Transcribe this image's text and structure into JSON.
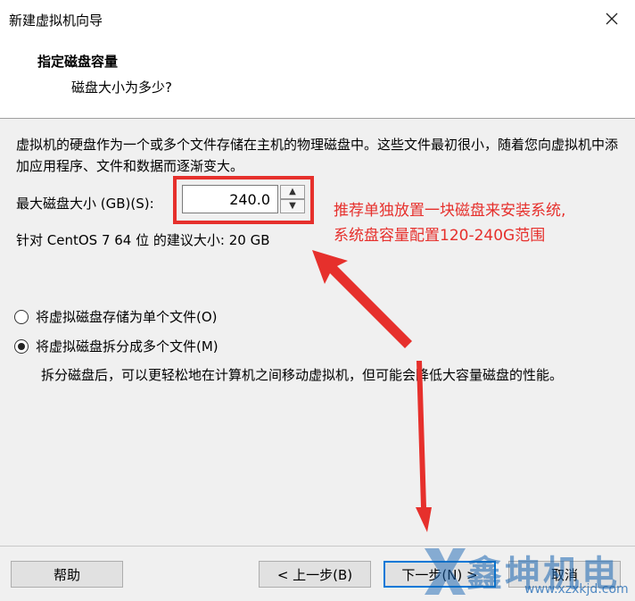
{
  "window": {
    "title": "新建虚拟机向导"
  },
  "header": {
    "title": "指定磁盘容量",
    "subtitle": "磁盘大小为多少?"
  },
  "description": "虚拟机的硬盘作为一个或多个文件存储在主机的物理磁盘中。这些文件最初很小，随着您向虚拟机中添加应用程序、文件和数据而逐渐变大。",
  "disk_size": {
    "label": "最大磁盘大小 (GB)(S):",
    "value": "240.0"
  },
  "recommendation": "针对 CentOS 7 64 位 的建议大小: 20 GB",
  "annotation": {
    "line1": "推荐单独放置一块磁盘来安装系统,",
    "line2": "系统盘容量配置120-240G范围",
    "color": "#e6302c"
  },
  "options": {
    "single_file_label": "将虚拟磁盘存储为单个文件(O)",
    "split_files_label": "将虚拟磁盘拆分成多个文件(M)",
    "split_description": "拆分磁盘后，可以更轻松地在计算机之间移动虚拟机，但可能会降低大容量磁盘的性能。",
    "selected": "split"
  },
  "buttons": {
    "help": "帮助",
    "back": "< 上一步(B)",
    "next": "下一步(N) >",
    "cancel": "取消"
  },
  "watermark": {
    "brand": "鑫坤机电",
    "url": "www.xzxkjd.com"
  },
  "icons": {
    "close": "close-icon",
    "spin_up": "chevron-up-icon",
    "spin_down": "chevron-down-icon",
    "logo": "x-logo-icon"
  }
}
